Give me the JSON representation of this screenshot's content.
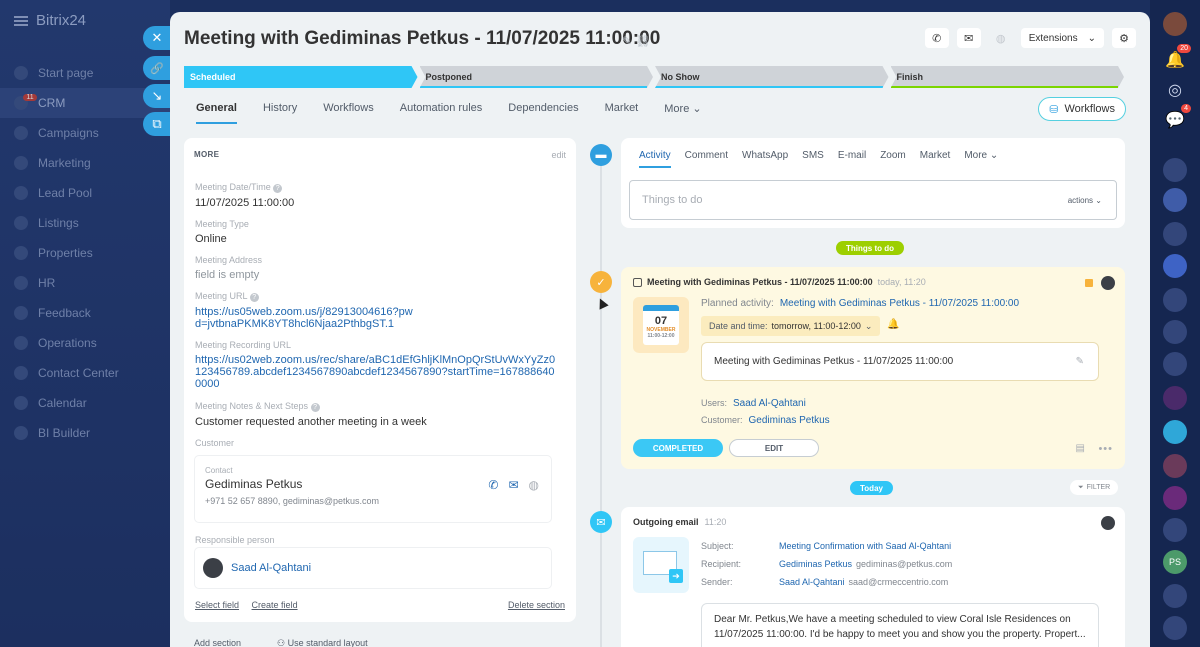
{
  "app": {
    "name": "Bitrix24"
  },
  "left_nav": {
    "items": [
      {
        "label": "Start page"
      },
      {
        "label": "CRM",
        "badge": "11"
      },
      {
        "label": "Campaigns"
      },
      {
        "label": "Marketing"
      },
      {
        "label": "Lead Pool"
      },
      {
        "label": "Listings"
      },
      {
        "label": "Properties"
      },
      {
        "label": "HR"
      },
      {
        "label": "Feedback"
      },
      {
        "label": "Operations"
      },
      {
        "label": "Contact Center"
      },
      {
        "label": "Calendar"
      },
      {
        "label": "BI Builder"
      }
    ]
  },
  "right_strip": {
    "badges": [
      "20",
      "4"
    ],
    "initials": "PS"
  },
  "header": {
    "title": "Meeting with Gediminas Petkus - 11/07/2025 11:00:00",
    "extensions_label": "Extensions"
  },
  "stages": [
    {
      "label": "Scheduled",
      "active": true,
      "color": "#2fc6f6"
    },
    {
      "label": "Postponed",
      "active": false,
      "color": "#2fc6f6"
    },
    {
      "label": "No Show",
      "active": false,
      "color": "#2fc6f6"
    },
    {
      "label": "Finish",
      "active": false,
      "color": "#7bd500"
    }
  ],
  "tabs": [
    "General",
    "History",
    "Workflows",
    "Automation rules",
    "Dependencies",
    "Market",
    "More"
  ],
  "workflows_button": "Workflows",
  "details": {
    "section_title": "MORE",
    "edit_label": "edit",
    "fields": [
      {
        "label": "Meeting Date/Time",
        "value": "11/07/2025 11:00:00"
      },
      {
        "label": "Meeting Type",
        "value": "Online"
      },
      {
        "label": "Meeting Address",
        "value": "field is empty"
      },
      {
        "label": "Meeting URL",
        "value": "https://us05web.zoom.us/j/82913004616?pwd=jvtbnaPKMK8YT8hcl6Njaa2PthbgST.1"
      },
      {
        "label": "Meeting Recording URL",
        "value": "https://us02web.zoom.us/rec/share/aBC1dEfGhljKlMnOpQrStUvWxYyZz0123456789.abcdef1234567890abcdef1234567890?startTime=1678886400000"
      },
      {
        "label": "Meeting Notes & Next Steps",
        "value": "Customer requested another meeting in a week"
      }
    ],
    "customer_label": "Customer",
    "contact_label": "Contact",
    "contact_name": "Gediminas Petkus",
    "contact_info": "+971 52 657 8890, gediminas@petkus.com",
    "responsible_label": "Responsible person",
    "responsible_name": "Saad Al-Qahtani",
    "select_field": "Select field",
    "create_field": "Create field",
    "delete_section": "Delete section",
    "add_section": "Add section",
    "standard_layout": "Use standard layout"
  },
  "composer": {
    "tabs": [
      "Activity",
      "Comment",
      "WhatsApp",
      "SMS",
      "E-mail",
      "Zoom",
      "Market",
      "More"
    ],
    "placeholder": "Things to do",
    "actions_label": "actions"
  },
  "timeline": {
    "todo_pill": "Things to do",
    "today_pill": "Today",
    "filter_label": "FILTER",
    "todo": {
      "title": "Meeting with Gediminas Petkus - 11/07/2025 11:00:00",
      "time": "today, 11:20",
      "cal_day": "07",
      "cal_month": "NOVEMBER",
      "cal_time": "11:00-12:00",
      "planned_label": "Planned activity:",
      "planned_value": "Meeting with Gediminas Petkus - 11/07/2025 11:00:00",
      "date_label": "Date and time:",
      "date_value": "tomorrow, 11:00-12:00",
      "description": "Meeting with Gediminas Petkus - 11/07/2025 11:00:00",
      "users_label": "Users:",
      "users_value": "Saad Al-Qahtani",
      "customer_label": "Customer:",
      "customer_value": "Gediminas Petkus",
      "completed_label": "COMPLETED",
      "edit_label": "EDIT"
    },
    "email": {
      "title": "Outgoing email",
      "time": "11:20",
      "subject_label": "Subject:",
      "subject_value": "Meeting Confirmation with Saad Al-Qahtani",
      "recipient_label": "Recipient:",
      "recipient_name": "Gediminas Petkus",
      "recipient_email": "gediminas@petkus.com",
      "sender_label": "Sender:",
      "sender_name": "Saad Al-Qahtani",
      "sender_email": "saad@crmeccentrio.com",
      "body": "Dear Mr. Petkus,We have a meeting scheduled to view Coral Isle Residences on 11/07/2025 11:00:00. I'd be happy to meet you and show you the property. Propert..."
    }
  }
}
